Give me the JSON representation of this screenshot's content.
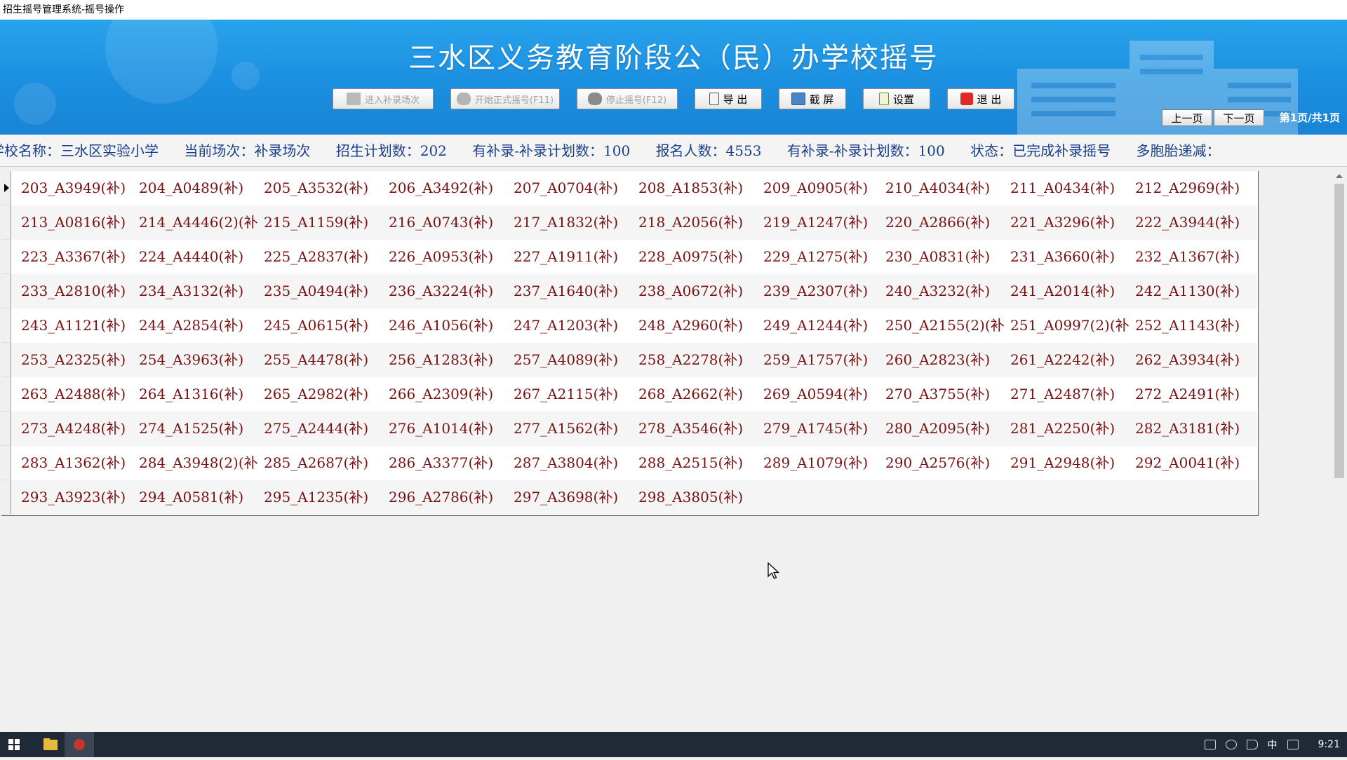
{
  "window": {
    "title": "招生摇号管理系统-摇号操作"
  },
  "header": {
    "title": "三水区义务教育阶段公（民）办学校摇号"
  },
  "toolbar": {
    "enter_makeup": "进入补录场次",
    "start_formal": "开始正式摇号(F11)",
    "stop": "停止摇号(F12)",
    "export": "导 出",
    "screenshot": "截 屏",
    "settings": "设置",
    "exit": "退 出"
  },
  "pager": {
    "prev": "上一页",
    "next": "下一页",
    "page_info": "第1页/共1页"
  },
  "info": {
    "school": "学校名称：三水区实验小学",
    "session": "当前场次：补录场次",
    "plan": "招生计划数：202",
    "makeup_plan": "有补录-补录计划数：100",
    "applicants": "报名人数：4553",
    "makeup_plan2": "有补录-补录计划数：100",
    "status": "状态：已完成补录摇号",
    "twins": "多胞胎递减："
  },
  "rows": [
    [
      "203_A3949(补)",
      "204_A0489(补)",
      "205_A3532(补)",
      "206_A3492(补)",
      "207_A0704(补)",
      "208_A1853(补)",
      "209_A0905(补)",
      "210_A4034(补)",
      "211_A0434(补)",
      "212_A2969(补)"
    ],
    [
      "213_A0816(补)",
      "214_A4446(2)(补",
      "215_A1159(补)",
      "216_A0743(补)",
      "217_A1832(补)",
      "218_A2056(补)",
      "219_A1247(补)",
      "220_A2866(补)",
      "221_A3296(补)",
      "222_A3944(补)"
    ],
    [
      "223_A3367(补)",
      "224_A4440(补)",
      "225_A2837(补)",
      "226_A0953(补)",
      "227_A1911(补)",
      "228_A0975(补)",
      "229_A1275(补)",
      "230_A0831(补)",
      "231_A3660(补)",
      "232_A1367(补)"
    ],
    [
      "233_A2810(补)",
      "234_A3132(补)",
      "235_A0494(补)",
      "236_A3224(补)",
      "237_A1640(补)",
      "238_A0672(补)",
      "239_A2307(补)",
      "240_A3232(补)",
      "241_A2014(补)",
      "242_A1130(补)"
    ],
    [
      "243_A1121(补)",
      "244_A2854(补)",
      "245_A0615(补)",
      "246_A1056(补)",
      "247_A1203(补)",
      "248_A2960(补)",
      "249_A1244(补)",
      "250_A2155(2)(补",
      "251_A0997(2)(补",
      "252_A1143(补)"
    ],
    [
      "253_A2325(补)",
      "254_A3963(补)",
      "255_A4478(补)",
      "256_A1283(补)",
      "257_A4089(补)",
      "258_A2278(补)",
      "259_A1757(补)",
      "260_A2823(补)",
      "261_A2242(补)",
      "262_A3934(补)"
    ],
    [
      "263_A2488(补)",
      "264_A1316(补)",
      "265_A2982(补)",
      "266_A2309(补)",
      "267_A2115(补)",
      "268_A2662(补)",
      "269_A0594(补)",
      "270_A3755(补)",
      "271_A2487(补)",
      "272_A2491(补)"
    ],
    [
      "273_A4248(补)",
      "274_A1525(补)",
      "275_A2444(补)",
      "276_A1014(补)",
      "277_A1562(补)",
      "278_A3546(补)",
      "279_A1745(补)",
      "280_A2095(补)",
      "281_A2250(补)",
      "282_A3181(补)"
    ],
    [
      "283_A1362(补)",
      "284_A3948(2)(补",
      "285_A2687(补)",
      "286_A3377(补)",
      "287_A3804(补)",
      "288_A2515(补)",
      "289_A1079(补)",
      "290_A2576(补)",
      "291_A2948(补)",
      "292_A0041(补)"
    ],
    [
      "293_A3923(补)",
      "294_A0581(补)",
      "295_A1235(补)",
      "296_A2786(补)",
      "297_A3698(补)",
      "298_A3805(补)"
    ]
  ],
  "taskbar": {
    "ime": "中",
    "time": "9:21"
  }
}
